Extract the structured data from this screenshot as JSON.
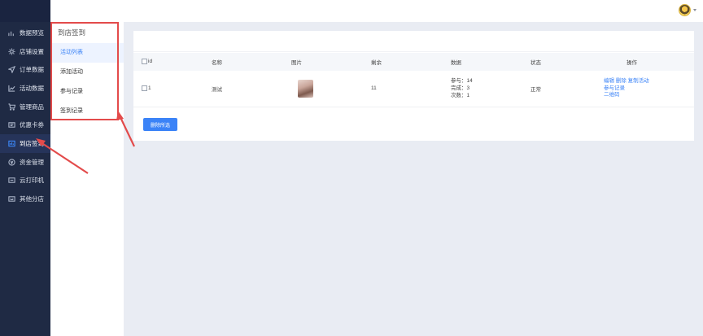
{
  "sidebar": {
    "items": [
      {
        "label": "数据预览",
        "icon": "bar-chart-icon"
      },
      {
        "label": "店铺设置",
        "icon": "gear-icon"
      },
      {
        "label": "订单数据",
        "icon": "send-icon"
      },
      {
        "label": "活动数据",
        "icon": "line-chart-icon"
      },
      {
        "label": "管理商品",
        "icon": "cart-icon"
      },
      {
        "label": "优惠卡券",
        "icon": "coupon-icon"
      },
      {
        "label": "到店签到",
        "icon": "checkin-icon"
      },
      {
        "label": "资金管理",
        "icon": "money-icon"
      },
      {
        "label": "云打印机",
        "icon": "printer-icon"
      },
      {
        "label": "其他分店",
        "icon": "store-icon"
      }
    ],
    "active_index": 6
  },
  "submenu": {
    "title": "到店签到",
    "items": [
      "活动列表",
      "添加活动",
      "参与记录",
      "签到记录"
    ],
    "active_index": 0
  },
  "table": {
    "headers": [
      "id",
      "名称",
      "图片",
      "剩余",
      "数据",
      "状态",
      "操作"
    ],
    "rows": [
      {
        "id": "1",
        "name": "测试",
        "remaining": "11",
        "stats": [
          "参与：14",
          "完成：3",
          "次数：1"
        ],
        "status": "正常",
        "ops": {
          "edit": "编辑",
          "delete": "删除",
          "copy": "复制活动",
          "records": "参与记录",
          "qrcode": "二维码"
        }
      }
    ]
  },
  "delete_selected": "删除所选",
  "colors": {
    "accent": "#3b83f7",
    "sidebar_bg": "#1f2a44",
    "highlight_red": "#e34b4b"
  }
}
